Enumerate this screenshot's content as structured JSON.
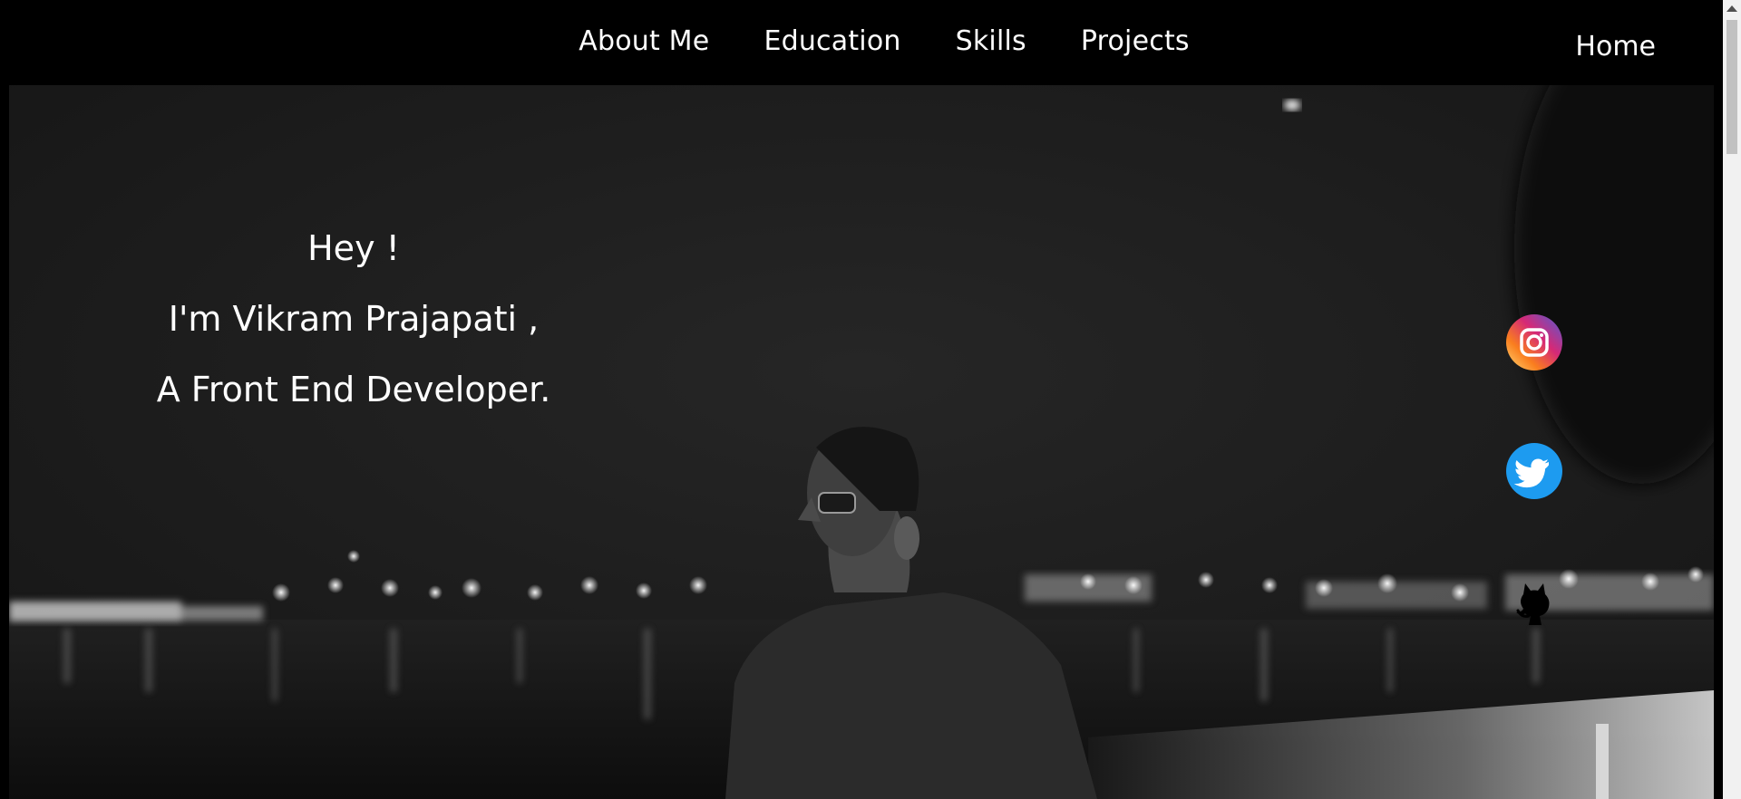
{
  "nav": {
    "links": [
      "About Me",
      "Education",
      "Skills",
      "Projects"
    ],
    "home": "Home"
  },
  "hero": {
    "line1": "Hey !",
    "line2": "I'm Vikram Prajapati ,",
    "line3": "A Front End Developer."
  },
  "social": {
    "icons": [
      "instagram-icon",
      "twitter-icon",
      "github-icon"
    ]
  },
  "colors": {
    "background": "#000000",
    "text": "#ffffff",
    "twitter": "#1d9bf0",
    "scrollbar_track": "#f1f1f1",
    "scrollbar_thumb": "#c1c1c1"
  }
}
